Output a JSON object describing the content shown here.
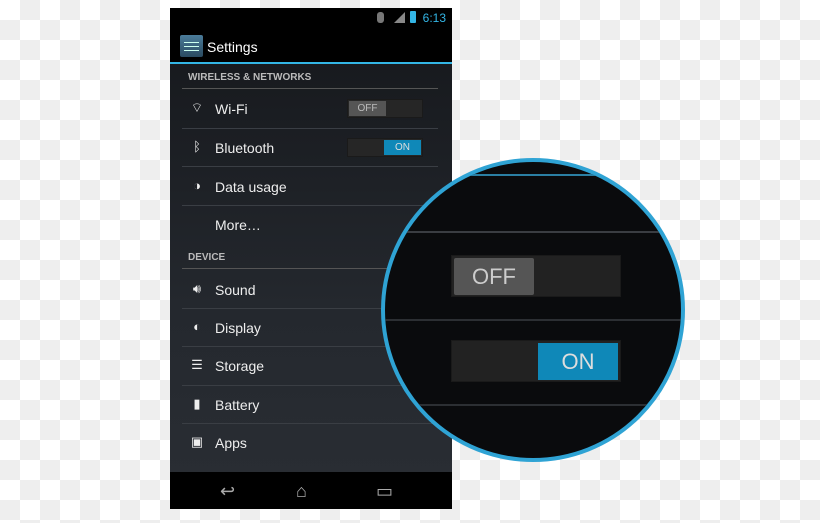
{
  "status_bar": {
    "time": "6:13",
    "icons": [
      "bluetooth-icon",
      "signal-icon",
      "battery-icon"
    ]
  },
  "action_bar": {
    "title": "Settings",
    "icon": "settings-icon"
  },
  "sections": [
    {
      "header": "WIRELESS & NETWORKS",
      "items": [
        {
          "label": "Wi-Fi",
          "icon": "wifi-icon",
          "toggle": "OFF"
        },
        {
          "label": "Bluetooth",
          "icon": "bluetooth-icon",
          "toggle": "ON"
        },
        {
          "label": "Data usage",
          "icon": "data-usage-icon"
        },
        {
          "label": "More…"
        }
      ]
    },
    {
      "header": "DEVICE",
      "items": [
        {
          "label": "Sound",
          "icon": "sound-icon"
        },
        {
          "label": "Display",
          "icon": "display-icon"
        },
        {
          "label": "Storage",
          "icon": "storage-icon"
        },
        {
          "label": "Battery",
          "icon": "battery-icon"
        },
        {
          "label": "Apps",
          "icon": "apps-icon"
        }
      ]
    }
  ],
  "magnifier": {
    "off_label": "OFF",
    "on_label": "ON"
  },
  "colors": {
    "accent": "#33b5e5",
    "toggle_on": "#0f88b8",
    "lens_border": "#2fa3d4"
  }
}
